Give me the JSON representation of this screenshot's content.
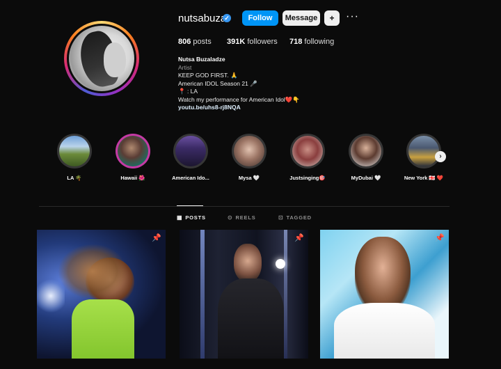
{
  "profile": {
    "username": "nutsabuza",
    "verified_icon": "verified-check-icon",
    "follow_label": "Follow",
    "message_label": "Message",
    "add_user_icon": "+",
    "more_icon": "···"
  },
  "stats": {
    "posts_value": "806",
    "posts_label": "posts",
    "followers_value": "391K",
    "followers_label": "followers",
    "following_value": "718",
    "following_label": "following"
  },
  "bio": {
    "name": "Nutsa Buzaladze",
    "category": "Artist",
    "line1": "KEEP GOD FIRST. 🙏",
    "line2": "American IDOL Season 21 🎤",
    "line3": "📍 : LA",
    "line4": "Watch my performance for American Idol❤️👇",
    "link": "youtu.be/uhs8-rj8NQA"
  },
  "highlights": [
    {
      "label": "LA 🌴",
      "icon": "highlight-la"
    },
    {
      "label": "Hawaii 🌺",
      "icon": "highlight-hawaii"
    },
    {
      "label": "American Ido...",
      "icon": "highlight-american-idol"
    },
    {
      "label": "Mysa 🤍",
      "icon": "highlight-mysa"
    },
    {
      "label": "Justsinging🎯",
      "icon": "highlight-justsinging"
    },
    {
      "label": "MyDubai 🤍",
      "icon": "highlight-mydubai"
    },
    {
      "label": "New York 🇬🇪 ❤️",
      "icon": "highlight-new-york"
    }
  ],
  "next_icon": "›",
  "tabs": [
    {
      "label": "POSTS",
      "icon": "▦",
      "active": true
    },
    {
      "label": "REELS",
      "icon": "⊙",
      "active": false
    },
    {
      "label": "TAGGED",
      "icon": "⊡",
      "active": false
    }
  ],
  "posts": [
    {
      "pinned": true,
      "pin_icon": "📌"
    },
    {
      "pinned": true,
      "pin_icon": "📌"
    },
    {
      "pinned": true,
      "pin_icon": "📌"
    }
  ],
  "colors": {
    "background": "#0b0b0b",
    "follow_button": "#0095f6",
    "verified_badge": "#3897f0",
    "highlight_ring": "#363636",
    "highlight_ring_active": "#c43aa4"
  }
}
